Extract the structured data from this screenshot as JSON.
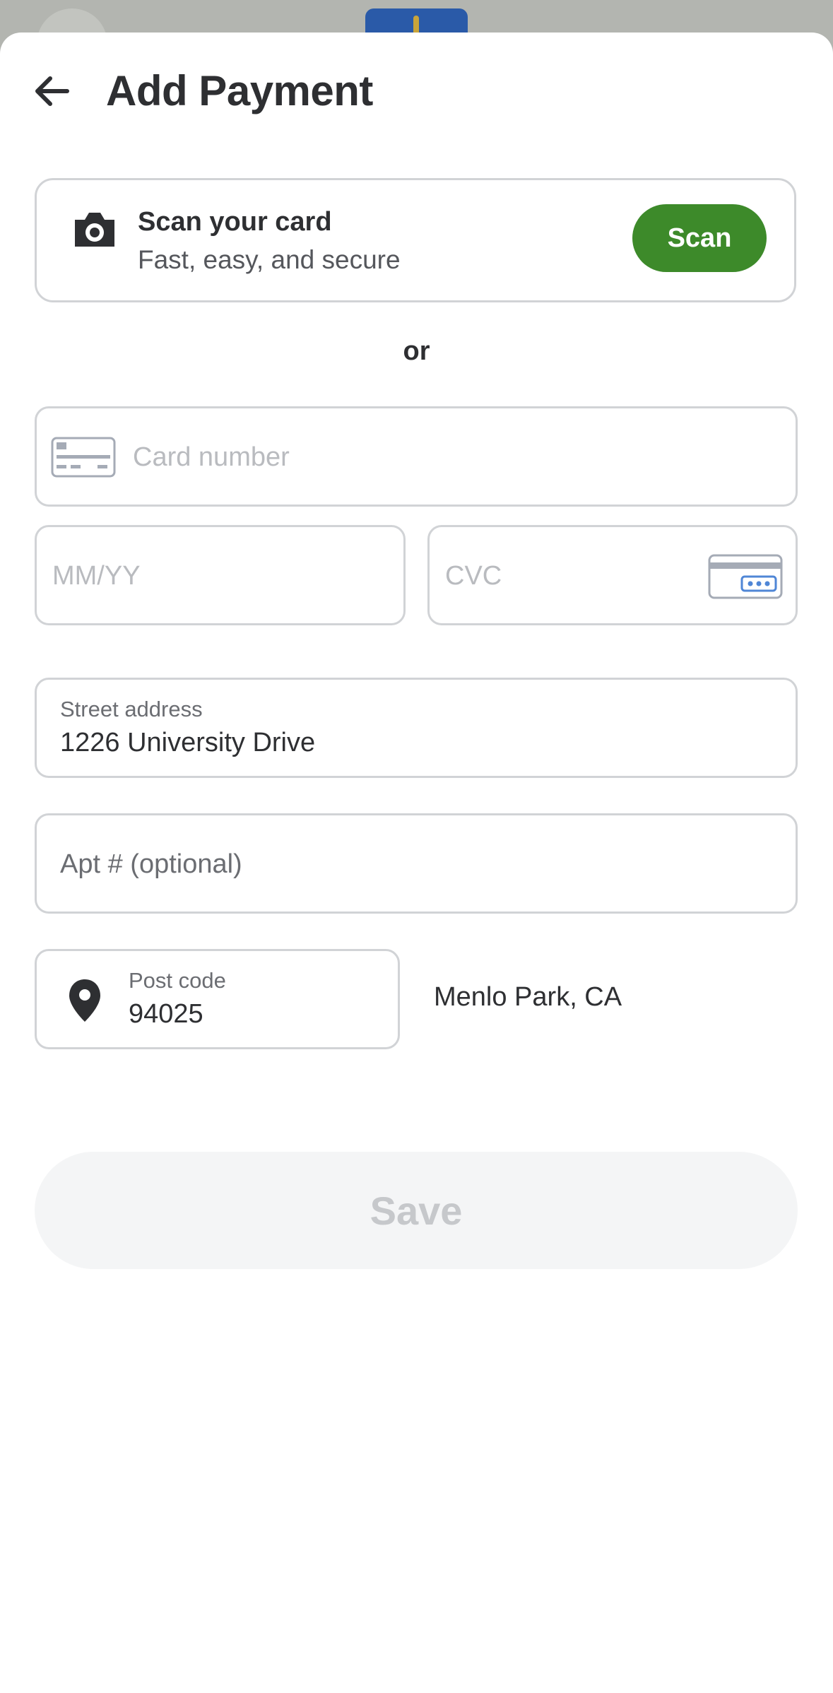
{
  "header": {
    "title": "Add Payment"
  },
  "scan": {
    "title": "Scan your card",
    "subtitle": "Fast, easy, and secure",
    "button_label": "Scan"
  },
  "divider_text": "or",
  "card_number": {
    "placeholder": "Card number"
  },
  "expiry": {
    "placeholder": "MM/YY"
  },
  "cvc": {
    "placeholder": "CVC"
  },
  "street": {
    "label": "Street address",
    "value": "1226 University Drive"
  },
  "apt": {
    "placeholder": "Apt # (optional)"
  },
  "postcode": {
    "label": "Post code",
    "value": "94025",
    "city": "Menlo Park, CA"
  },
  "save_label": "Save",
  "colors": {
    "accent_green": "#3d8a2a",
    "border": "#d1d3d6",
    "placeholder": "#b9bbbf"
  },
  "icons": [
    "back-arrow-icon",
    "camera-icon",
    "credit-card-icon",
    "cvc-card-icon",
    "location-pin-icon"
  ]
}
